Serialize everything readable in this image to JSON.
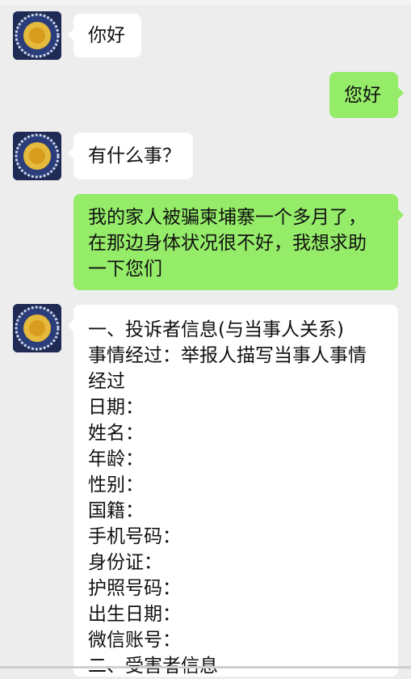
{
  "messages": [
    {
      "side": "in",
      "text": "你好"
    },
    {
      "side": "out",
      "text": "您好"
    },
    {
      "side": "in",
      "text": "有什么事？"
    },
    {
      "side": "out",
      "lines": [
        "我的家人被骗柬埔寨一个多月了，",
        "在那边身体状况很不好，我想求助",
        "一下您们"
      ]
    },
    {
      "side": "in",
      "lines": [
        "一、投诉者信息(与当事人关系)",
        "事情经过：举报人描写当事人事情",
        "经过",
        "日期：",
        "姓名：",
        "年龄：",
        "性别：",
        "国籍：",
        "手机号码：",
        "身份证：",
        "护照号码：",
        "出生日期：",
        "微信账号：",
        "二、受害者信息"
      ]
    }
  ],
  "colors": {
    "background": "#ededed",
    "incoming_bubble": "#ffffff",
    "outgoing_bubble": "#95ec69",
    "avatar": "#1f2a55"
  }
}
